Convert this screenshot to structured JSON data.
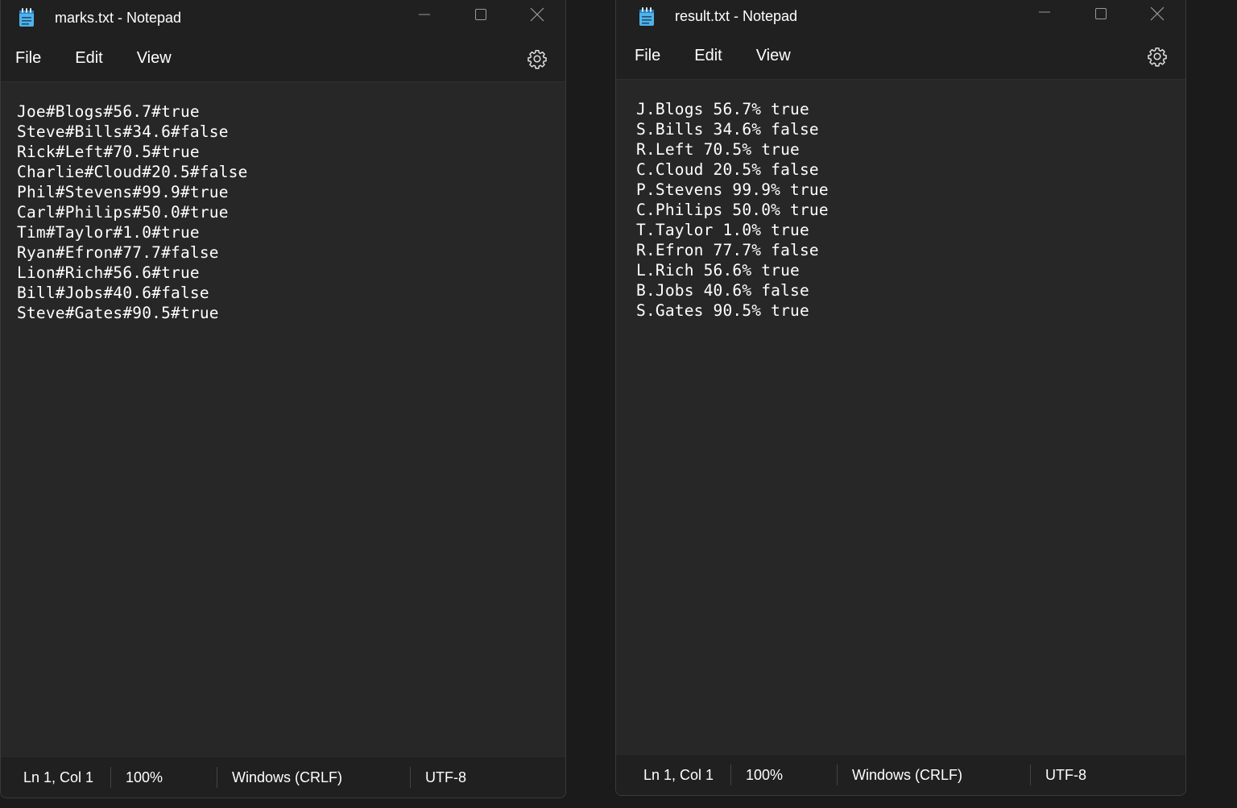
{
  "colors": {
    "window_bg": "#272727",
    "titlebar_bg": "#202020",
    "text": "#ffffff",
    "icon_accent": "#4fb3e8"
  },
  "icons": {
    "app": "notepad-icon",
    "minimize": "minimize-icon",
    "maximize": "maximize-icon",
    "close": "close-icon",
    "settings": "gear-icon"
  },
  "left_window": {
    "title": "marks.txt - Notepad",
    "menu": {
      "file": "File",
      "edit": "Edit",
      "view": "View"
    },
    "lines": [
      "Joe#Blogs#56.7#true",
      "Steve#Bills#34.6#false",
      "Rick#Left#70.5#true",
      "Charlie#Cloud#20.5#false",
      "Phil#Stevens#99.9#true",
      "Carl#Philips#50.0#true",
      "Tim#Taylor#1.0#true",
      "Ryan#Efron#77.7#false",
      "Lion#Rich#56.6#true",
      "Bill#Jobs#40.6#false",
      "Steve#Gates#90.5#true"
    ],
    "status": {
      "position": "Ln 1, Col 1",
      "zoom": "100%",
      "line_ending": "Windows (CRLF)",
      "encoding": "UTF-8"
    }
  },
  "right_window": {
    "title": "result.txt - Notepad",
    "menu": {
      "file": "File",
      "edit": "Edit",
      "view": "View"
    },
    "lines": [
      "J.Blogs 56.7% true",
      "S.Bills 34.6% false",
      "R.Left 70.5% true",
      "C.Cloud 20.5% false",
      "P.Stevens 99.9% true",
      "C.Philips 50.0% true",
      "T.Taylor 1.0% true",
      "R.Efron 77.7% false",
      "L.Rich 56.6% true",
      "B.Jobs 40.6% false",
      "S.Gates 90.5% true"
    ],
    "status": {
      "position": "Ln 1, Col 1",
      "zoom": "100%",
      "line_ending": "Windows (CRLF)",
      "encoding": "UTF-8"
    }
  }
}
